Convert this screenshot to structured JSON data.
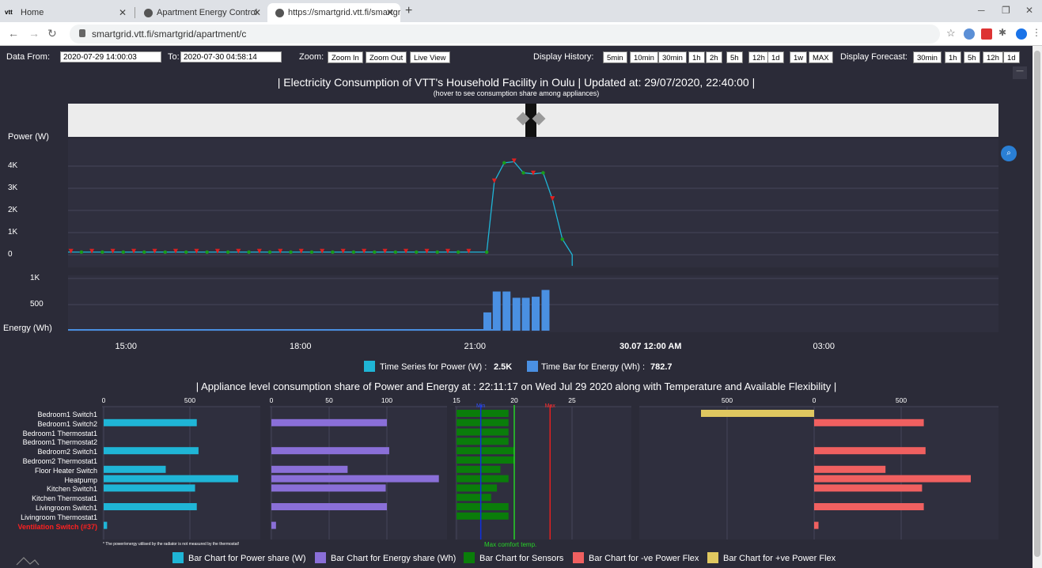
{
  "browser": {
    "tabs": [
      {
        "title": "Home",
        "active": false
      },
      {
        "title": "Apartment Energy Control",
        "active": false
      },
      {
        "title": "https://smartgrid.vtt.fi/smartgrid",
        "active": true
      }
    ],
    "url": "smartgrid.vtt.fi/smartgrid/apartment/c"
  },
  "controls": {
    "data_from_label": "Data From:",
    "data_from_value": "2020-07-29   14:00:03",
    "to_label": "To:",
    "to_value": "2020-07-30   04:58:14",
    "zoom_label": "Zoom:",
    "zoom_in": "Zoom In",
    "zoom_out": "Zoom Out",
    "live_view": "Live View",
    "display_history_label": "Display History:",
    "history_options": [
      "5min",
      "10min",
      "30min",
      "1h",
      "2h",
      "5h",
      "12h",
      "1d",
      "1w",
      "MAX"
    ],
    "display_forecast_label": "Display Forecast:",
    "forecast_options": [
      "30min",
      "1h",
      "5h",
      "12h",
      "1d"
    ]
  },
  "main_chart": {
    "title": "| Electricity Consumption of VTT's Household Facility in Oulu | Updated at: 29/07/2020, 22:40:00 |",
    "subtitle": "(hover to see consumption share among appliances)",
    "power_label": "Power (W)",
    "energy_label": "Energy (Wh)",
    "x_ticks": [
      "15:00",
      "18:00",
      "21:00",
      "30.07 12:00 AM",
      "03:00"
    ],
    "power_y_ticks": [
      "4K",
      "3K",
      "2K",
      "1K",
      "0"
    ],
    "energy_y_ticks": [
      "1K",
      "500"
    ],
    "legend_power": "Time Series for Power (W) :",
    "legend_power_value": "2.5K",
    "legend_energy": "Time Bar for Energy (Wh) :",
    "legend_energy_value": "782.7",
    "color_power": "#1fb5d6",
    "color_energy": "#4a90e2"
  },
  "chart_data": [
    {
      "type": "line",
      "title": "| Electricity Consumption of VTT's Household Facility in Oulu | Updated at: 29/07/2020, 22:40:00 |",
      "ylabel": "Power (W)",
      "ylim": [
        0,
        4500
      ],
      "x_hours": [
        14.0,
        14.5,
        15.0,
        15.5,
        16.0,
        16.5,
        17.0,
        17.5,
        18.0,
        18.5,
        19.0,
        19.5,
        20.0,
        20.5,
        21.0,
        21.2,
        21.33,
        21.5,
        21.67,
        21.83,
        22.0,
        22.17,
        22.33,
        22.5,
        22.67
      ],
      "values": [
        120,
        120,
        120,
        120,
        120,
        120,
        120,
        120,
        120,
        120,
        120,
        120,
        120,
        120,
        120,
        120,
        3300,
        4150,
        4200,
        3700,
        3650,
        3700,
        2500,
        700,
        -200
      ]
    },
    {
      "type": "bar",
      "ylabel": "Energy (Wh)",
      "ylim": [
        0,
        1000
      ],
      "x_hours": [
        14.0,
        14.5,
        15.0,
        15.5,
        16.0,
        16.5,
        17.0,
        17.5,
        18.0,
        18.5,
        19.0,
        19.5,
        20.0,
        20.5,
        21.0,
        21.17,
        21.33,
        21.5,
        21.67,
        21.83,
        22.0,
        22.17,
        22.33
      ],
      "values": [
        30,
        30,
        30,
        30,
        30,
        30,
        30,
        30,
        30,
        30,
        30,
        30,
        30,
        30,
        30,
        350,
        750,
        750,
        630,
        630,
        650,
        780,
        0
      ]
    },
    {
      "type": "bar",
      "title": "| Appliance level consumption share of Power and Energy at : 22:11:17 on Wed Jul 29 2020 along with Temperature and Available Flexibility |",
      "categories": [
        "Bedroom1 Switch1",
        "Bedroom1 Switch2",
        "Bedroom1 Thermostat1",
        "Bedroom1 Thermostat2",
        "Bedroom2 Switch1",
        "Bedroom2 Thermostat1",
        "Floor Heater Switch",
        "Heatpump",
        "Kitchen Switch1",
        "Kitchen Thermostat1",
        "Livingroom Switch1",
        "Livingroom Thermostat1",
        "Ventilation Switch (#37)"
      ],
      "series": [
        {
          "name": "Bar Chart for Power share (W)",
          "values": [
            0,
            540,
            0,
            0,
            550,
            0,
            360,
            780,
            530,
            0,
            540,
            0,
            20
          ]
        },
        {
          "name": "Bar Chart for Energy share (Wh)",
          "values": [
            0,
            100,
            0,
            0,
            102,
            0,
            66,
            145,
            99,
            0,
            100,
            0,
            4
          ]
        },
        {
          "name": "Bar Chart for Sensors",
          "values": [
            19.5,
            19.5,
            19.5,
            19.5,
            20.0,
            20.0,
            18.8,
            19.5,
            18.5,
            18.0,
            19.5,
            19.5,
            15.0
          ]
        },
        {
          "name": "Bar Chart for -ve Power Flex",
          "values": [
            0,
            630,
            0,
            0,
            640,
            0,
            410,
            900,
            620,
            0,
            630,
            0,
            25
          ]
        },
        {
          "name": "Bar Chart for +ve Power Flex",
          "values": [
            -650,
            0,
            0,
            0,
            0,
            0,
            0,
            0,
            0,
            0,
            0,
            0,
            0
          ]
        }
      ]
    }
  ],
  "bottom_chart": {
    "title": "| Appliance level consumption share of Power and Energy at : 22:11:17 on Wed Jul 29 2020 along with Temperature and Available Flexibility |",
    "power_ticks": [
      "0",
      "500"
    ],
    "energy_ticks": [
      "0",
      "50",
      "100"
    ],
    "sensor_ticks": [
      "15",
      "20",
      "25"
    ],
    "min_label": "Min",
    "max_label": "Max",
    "max_comfort_label": "Max comfort temp.",
    "flex_ticks": [
      "500",
      "0",
      "500"
    ],
    "footnote": "* The power/energy utilised by the radiator is not measured by the thermostat!",
    "legend": [
      {
        "label": "Bar Chart for Power share (W)",
        "color": "#1fb5d6"
      },
      {
        "label": "Bar Chart for Energy share (Wh)",
        "color": "#8a6fd8"
      },
      {
        "label": "Bar Chart for Sensors",
        "color": "#0a7d0a"
      },
      {
        "label": "Bar Chart for -ve Power Flex",
        "color": "#f06060"
      },
      {
        "label": "Bar Chart for +ve Power Flex",
        "color": "#e0c860"
      }
    ]
  }
}
